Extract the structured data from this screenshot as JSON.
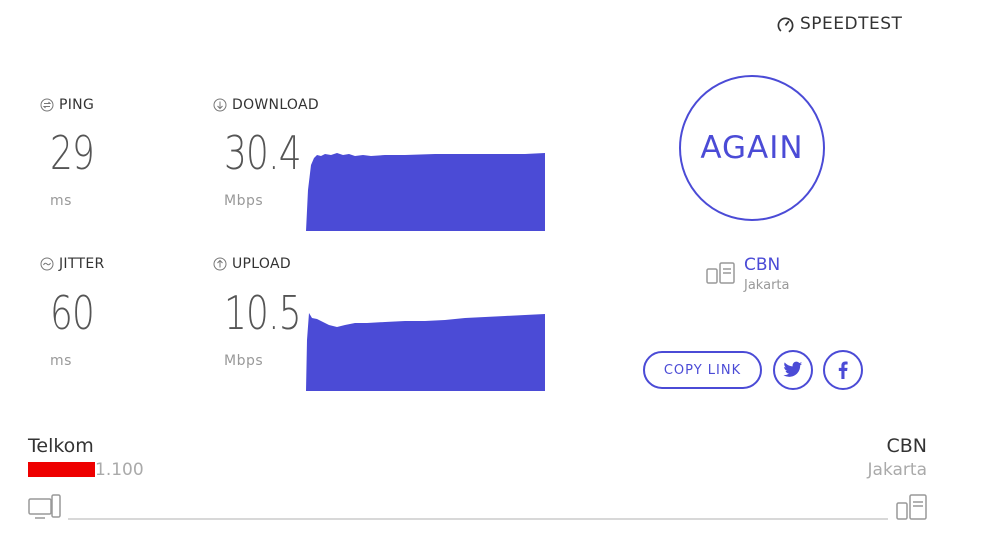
{
  "brand": {
    "name": "SPEEDTEST",
    "icon": "speedometer-icon"
  },
  "metrics": {
    "ping": {
      "label": "PING",
      "value": "29",
      "unit": "ms",
      "icon": "ping-icon"
    },
    "jitter": {
      "label": "JITTER",
      "value": "60",
      "unit": "ms",
      "icon": "jitter-icon"
    },
    "download": {
      "label": "DOWNLOAD",
      "value": "30.4",
      "unit": "Mbps",
      "icon": "download-arrow-icon"
    },
    "upload": {
      "label": "UPLOAD",
      "value": "10.5",
      "unit": "Mbps",
      "icon": "upload-arrow-icon"
    }
  },
  "actions": {
    "again_label": "AGAIN",
    "copy_link_label": "COPY LINK",
    "twitter_icon": "twitter-icon",
    "facebook_icon": "facebook-icon"
  },
  "server": {
    "name": "CBN",
    "location": "Jakarta",
    "icon": "server-icon"
  },
  "footer": {
    "isp_name": "Telkom",
    "isp_ip": "1.100",
    "server_name": "CBN",
    "server_location": "Jakarta",
    "client_icon": "client-device-icon",
    "server_icon": "server-icon"
  },
  "colors": {
    "accent": "#4b4bd6",
    "graph": "#4b4bd6",
    "redaction": "#ee0000"
  }
}
